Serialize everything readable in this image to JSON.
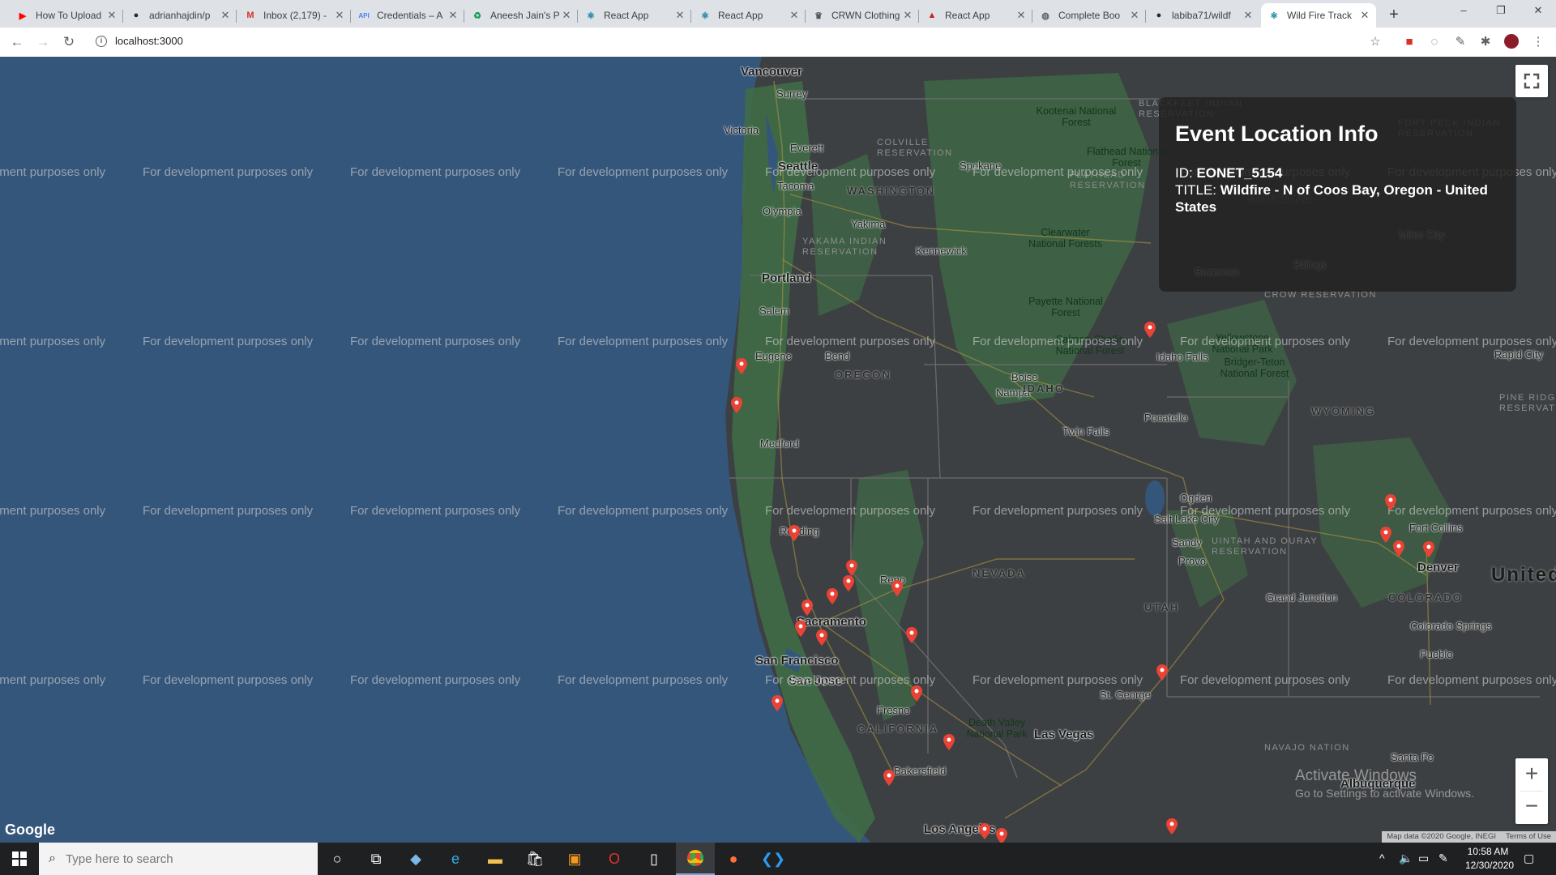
{
  "browser": {
    "tabs": [
      {
        "title": "How To Upload",
        "icon": "youtube-icon",
        "color": "#ff0000"
      },
      {
        "title": "adrianhajdin/p",
        "icon": "github-icon",
        "color": "#24292e"
      },
      {
        "title": "Inbox (2,179) -",
        "icon": "gmail-icon",
        "color": "#d93025"
      },
      {
        "title": "Credentials – A",
        "icon": "api-icon",
        "color": "#4285f4"
      },
      {
        "title": "Aneesh Jain's P",
        "icon": "leaf-icon",
        "color": "#0f9d58"
      },
      {
        "title": "React App",
        "icon": "react-icon",
        "color": "#0a7ea4"
      },
      {
        "title": "React App",
        "icon": "react-icon",
        "color": "#0a7ea4"
      },
      {
        "title": "CRWN Clothing",
        "icon": "crown-icon",
        "color": "#555555"
      },
      {
        "title": "React App",
        "icon": "bottle-icon",
        "color": "#c5221f"
      },
      {
        "title": "Complete Boo",
        "icon": "globe-icon",
        "color": "#5f6368"
      },
      {
        "title": "labiba71/wildf",
        "icon": "github-icon",
        "color": "#24292e"
      },
      {
        "title": "Wild Fire Track",
        "icon": "react-icon",
        "color": "#0a7ea4",
        "active": true
      }
    ],
    "new_tab": "+",
    "url": "localhost:3000",
    "window_controls": {
      "minimize": "–",
      "restore": "❐",
      "close": "✕"
    }
  },
  "map": {
    "watermark": "For development purposes only",
    "info_box": {
      "heading": "Event Location Info",
      "id_label": "ID:",
      "id_value": "EONET_5154",
      "title_label": "TITLE:",
      "title_value": "Wildfire - N of Coos Bay, Oregon - United States"
    },
    "cities": [
      "Vancouver",
      "Surrey",
      "Victoria",
      "Everett",
      "Seattle",
      "Tacoma",
      "Olympia",
      "Yakima",
      "Spokane",
      "Kennewick",
      "Portland",
      "Salem",
      "Eugene",
      "Bend",
      "Medford",
      "Boise",
      "Nampa",
      "Idaho Falls",
      "Pocatello",
      "Twin Falls",
      "Billings",
      "Bozeman",
      "Rapid City",
      "Ogden",
      "Salt Lake City",
      "Sandy",
      "Provo",
      "Fort Collins",
      "Denver",
      "Colorado Springs",
      "Pueblo",
      "Grand Junction",
      "Redding",
      "Reno",
      "Sacramento",
      "San Francisco",
      "San Jose",
      "Fresno",
      "Bakersfield",
      "Las Vegas",
      "St. George",
      "Santa Fe",
      "Albuquerque",
      "Los Angeles",
      "Miles City"
    ],
    "states": [
      "WASHINGTON",
      "OREGON",
      "IDAHO",
      "NEVADA",
      "UTAH",
      "CALIFORNIA",
      "COLORADO",
      "WYOMING",
      "MONTANA"
    ],
    "country_label": "United",
    "parks": [
      "Kootenai National Forest",
      "Flathead National Forest",
      "Clearwater National Forests",
      "Payette National Forest",
      "Salmon-Challis National Forest",
      "Yellowstone National Park",
      "Bridger-Teton National Forest",
      "Death Valley National Park"
    ],
    "reservations": [
      "COLVILLE RESERVATION",
      "YAKAMA INDIAN RESERVATION",
      "UINTAH AND OURAY RESERVATION",
      "NAVAJO NATION",
      "FORT PECK INDIAN RESERVATION",
      "BLACKFEET INDIAN RESERVATION",
      "FLATHEAD RESERVATION",
      "CROW RESERVATION",
      "PINE RIDGE RESERVATION"
    ],
    "markers_count": 24,
    "google_logo": "Google",
    "footer": {
      "data": "Map data ©2020 Google, INEGI",
      "terms": "Terms of Use"
    },
    "zoom_in": "+",
    "zoom_out": "−",
    "activate": {
      "line1": "Activate Windows",
      "line2": "Go to Settings to activate Windows."
    }
  },
  "taskbar": {
    "search_placeholder": "Type here to search",
    "time": "10:58 AM",
    "date": "12/30/2020"
  },
  "colors": {
    "water": "#35567b",
    "land": "#3c3f42",
    "forest": "#3f6b46",
    "marker": "#ea4335",
    "accent": "#1a73e8"
  }
}
